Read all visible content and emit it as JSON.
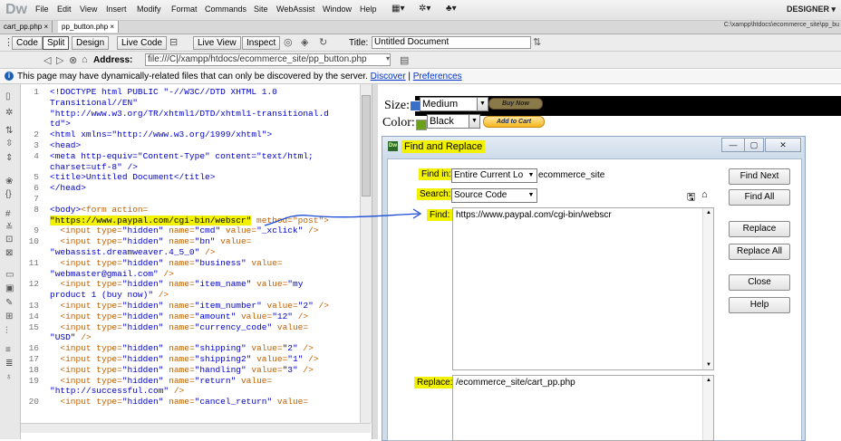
{
  "app": {
    "logo": "Dw",
    "menu": [
      "File",
      "Edit",
      "View",
      "Insert",
      "Modify",
      "Format",
      "Commands",
      "Site",
      "WebAssist",
      "Window",
      "Help"
    ],
    "workspace": "DESIGNER ▾"
  },
  "tabs": {
    "items": [
      "cart_pp.php ×",
      "pp_button.php ×"
    ],
    "path": "C:\\xampp\\htdocs\\ecommerce_site\\pp_bu"
  },
  "toolbar": {
    "code": "Code",
    "split": "Split",
    "design": "Design",
    "live_code": "Live Code",
    "live_view": "Live View",
    "inspect": "Inspect",
    "title_label": "Title:",
    "title_value": "Untitled Document"
  },
  "address": {
    "label": "Address:",
    "value": "file:///C|/xampp/htdocs/ecommerce_site/pp_button.php"
  },
  "infobar": {
    "text": "This page may have dynamically-related files that can only be discovered by the server.",
    "discover": "Discover",
    "sep": "|",
    "preferences": "Preferences"
  },
  "code": {
    "lines": [
      {
        "n": "1",
        "parts": [
          [
            "t",
            "<!DOCTYPE html PUBLIC \"-//W3C//DTD XHTML 1.0"
          ]
        ]
      },
      {
        "n": "",
        "parts": [
          [
            "t",
            "Transitional//EN\""
          ]
        ]
      },
      {
        "n": "",
        "parts": [
          [
            "t",
            "\"http://www.w3.org/TR/xhtml1/DTD/xhtml1-transitional.d"
          ]
        ]
      },
      {
        "n": "",
        "parts": [
          [
            "t",
            "td\">"
          ]
        ]
      },
      {
        "n": "2",
        "parts": [
          [
            "t",
            "<html xmlns=\"http://www.w3.org/1999/xhtml\">"
          ]
        ]
      },
      {
        "n": "3",
        "parts": [
          [
            "t",
            "<head>"
          ]
        ]
      },
      {
        "n": "4",
        "parts": [
          [
            "t",
            "<meta http-equiv=\"Content-Type\" content=\"text/html;"
          ]
        ]
      },
      {
        "n": "",
        "parts": [
          [
            "t",
            "charset=utf-8\" />"
          ]
        ]
      },
      {
        "n": "5",
        "parts": [
          [
            "t",
            "<title>Untitled Document</title>"
          ]
        ]
      },
      {
        "n": "6",
        "parts": [
          [
            "t",
            "</head>"
          ]
        ]
      },
      {
        "n": "7",
        "parts": [
          [
            "t",
            ""
          ]
        ]
      },
      {
        "n": "8",
        "parts": [
          [
            "t",
            "<body>"
          ],
          [
            "o",
            "<form action="
          ]
        ]
      },
      {
        "n": "",
        "parts": [
          [
            "hl",
            "\"https://www.paypal.com/cgi-bin/webscr\""
          ],
          [
            "o",
            " method=\"post\">"
          ]
        ]
      },
      {
        "n": "9",
        "parts": [
          [
            "o",
            "  <input type="
          ],
          [
            "s",
            "\"hidden\""
          ],
          [
            "o",
            " name="
          ],
          [
            "s",
            "\"cmd\""
          ],
          [
            "o",
            " value="
          ],
          [
            "s",
            "\"_xclick\""
          ],
          [
            "o",
            " />"
          ]
        ]
      },
      {
        "n": "10",
        "parts": [
          [
            "o",
            "  <input type="
          ],
          [
            "s",
            "\"hidden\""
          ],
          [
            "o",
            " name="
          ],
          [
            "s",
            "\"bn\""
          ],
          [
            "o",
            " value="
          ]
        ]
      },
      {
        "n": "",
        "parts": [
          [
            "s",
            "\"webassist.dreamweaver.4_5_0\""
          ],
          [
            "o",
            " />"
          ]
        ]
      },
      {
        "n": "11",
        "parts": [
          [
            "o",
            "  <input type="
          ],
          [
            "s",
            "\"hidden\""
          ],
          [
            "o",
            " name="
          ],
          [
            "s",
            "\"business\""
          ],
          [
            "o",
            " value="
          ]
        ]
      },
      {
        "n": "",
        "parts": [
          [
            "s",
            "\"webmaster@gmail.com\""
          ],
          [
            "o",
            " />"
          ]
        ]
      },
      {
        "n": "12",
        "parts": [
          [
            "o",
            "  <input type="
          ],
          [
            "s",
            "\"hidden\""
          ],
          [
            "o",
            " name="
          ],
          [
            "s",
            "\"item_name\""
          ],
          [
            "o",
            " value="
          ],
          [
            "s",
            "\"my"
          ]
        ]
      },
      {
        "n": "",
        "parts": [
          [
            "s",
            "product 1 (buy now)\""
          ],
          [
            "o",
            " />"
          ]
        ]
      },
      {
        "n": "13",
        "parts": [
          [
            "o",
            "  <input type="
          ],
          [
            "s",
            "\"hidden\""
          ],
          [
            "o",
            " name="
          ],
          [
            "s",
            "\"item_number\""
          ],
          [
            "o",
            " value="
          ],
          [
            "s",
            "\"2\""
          ],
          [
            "o",
            " />"
          ]
        ]
      },
      {
        "n": "14",
        "parts": [
          [
            "o",
            "  <input type="
          ],
          [
            "s",
            "\"hidden\""
          ],
          [
            "o",
            " name="
          ],
          [
            "s",
            "\"amount\""
          ],
          [
            "o",
            " value="
          ],
          [
            "s",
            "\"12\""
          ],
          [
            "o",
            " />"
          ]
        ]
      },
      {
        "n": "15",
        "parts": [
          [
            "o",
            "  <input type="
          ],
          [
            "s",
            "\"hidden\""
          ],
          [
            "o",
            " name="
          ],
          [
            "s",
            "\"currency_code\""
          ],
          [
            "o",
            " value="
          ]
        ]
      },
      {
        "n": "",
        "parts": [
          [
            "s",
            "\"USD\""
          ],
          [
            "o",
            " />"
          ]
        ]
      },
      {
        "n": "16",
        "parts": [
          [
            "o",
            "  <input type="
          ],
          [
            "s",
            "\"hidden\""
          ],
          [
            "o",
            " name="
          ],
          [
            "s",
            "\"shipping\""
          ],
          [
            "o",
            " value="
          ],
          [
            "s",
            "\"2\""
          ],
          [
            "o",
            " />"
          ]
        ]
      },
      {
        "n": "17",
        "parts": [
          [
            "o",
            "  <input type="
          ],
          [
            "s",
            "\"hidden\""
          ],
          [
            "o",
            " name="
          ],
          [
            "s",
            "\"shipping2\""
          ],
          [
            "o",
            " value="
          ],
          [
            "s",
            "\"1\""
          ],
          [
            "o",
            " />"
          ]
        ]
      },
      {
        "n": "18",
        "parts": [
          [
            "o",
            "  <input type="
          ],
          [
            "s",
            "\"hidden\""
          ],
          [
            "o",
            " name="
          ],
          [
            "s",
            "\"handling\""
          ],
          [
            "o",
            " value="
          ],
          [
            "s",
            "\"3\""
          ],
          [
            "o",
            " />"
          ]
        ]
      },
      {
        "n": "19",
        "parts": [
          [
            "o",
            "  <input type="
          ],
          [
            "s",
            "\"hidden\""
          ],
          [
            "o",
            " name="
          ],
          [
            "s",
            "\"return\""
          ],
          [
            "o",
            " value="
          ]
        ]
      },
      {
        "n": "",
        "parts": [
          [
            "s",
            "\"http://successful.com\""
          ],
          [
            "o",
            " />"
          ]
        ]
      },
      {
        "n": "20",
        "parts": [
          [
            "o",
            "  <input type="
          ],
          [
            "s",
            "\"hidden\""
          ],
          [
            "o",
            " name="
          ],
          [
            "s",
            "\"cancel_return\""
          ],
          [
            "o",
            " value="
          ]
        ]
      }
    ]
  },
  "design": {
    "size_label": "Size:",
    "size_value": "Medium",
    "buy_now": "Buy Now",
    "color_label": "Color:",
    "color_value": "Black",
    "add_to_cart": "Add to Cart"
  },
  "dialog": {
    "title": "Find and Replace",
    "find_in_label": "Find in:",
    "find_in_value": "Entire Current Lo",
    "site_name": "ecommerce_site",
    "search_label": "Search:",
    "search_value": "Source Code",
    "find_label": "Find:",
    "find_value": "https://www.paypal.com/cgi-bin/webscr",
    "replace_label": "Replace:",
    "replace_value": "/ecommerce_site/cart_pp.php",
    "buttons": {
      "find_next": "Find Next",
      "find_all": "Find All",
      "replace": "Replace",
      "replace_all": "Replace All",
      "close": "Close",
      "help": "Help"
    }
  }
}
